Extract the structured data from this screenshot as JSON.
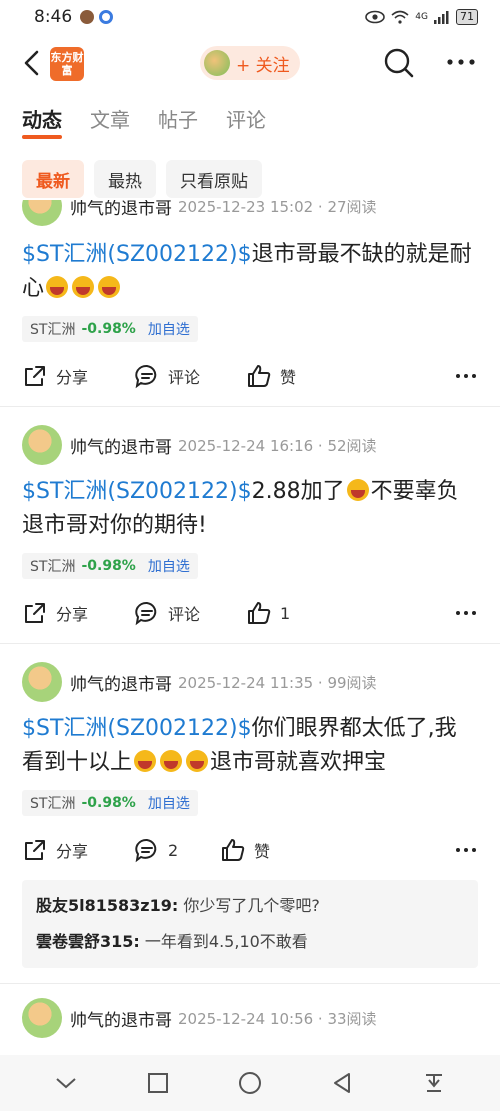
{
  "status_bar": {
    "time": "8:46",
    "network": "4G",
    "battery": "71"
  },
  "header": {
    "logo_text": "东方财富",
    "follow_label": "+ 关注"
  },
  "tabs": [
    {
      "label": "动态",
      "active": true
    },
    {
      "label": "文章",
      "active": false
    },
    {
      "label": "帖子",
      "active": false
    },
    {
      "label": "评论",
      "active": false
    }
  ],
  "filters": [
    {
      "label": "最新",
      "active": true
    },
    {
      "label": "最热",
      "active": false
    },
    {
      "label": "只看原贴",
      "active": false
    }
  ],
  "posts": [
    {
      "author": "帅气的退市哥",
      "meta": "2025-12-23 15:02 · 27阅读",
      "ticker": "$ST汇洲(SZ002122)$",
      "text": "退市哥最不缺的就是耐心",
      "emoji_count": 3,
      "stock": {
        "name": "ST汇洲",
        "change": "-0.98%",
        "add": "加自选"
      },
      "share": "分享",
      "comment": "评论",
      "like": "赞"
    },
    {
      "author": "帅气的退市哥",
      "meta": "2025-12-24 16:16 · 52阅读",
      "ticker": "$ST汇洲(SZ002122)$",
      "text_before": "2.88加了",
      "text_after": "不要辜负退市哥对你的期待!",
      "stock": {
        "name": "ST汇洲",
        "change": "-0.98%",
        "add": "加自选"
      },
      "share": "分享",
      "comment": "评论",
      "like": "1"
    },
    {
      "author": "帅气的退市哥",
      "meta": "2025-12-24 11:35 · 99阅读",
      "ticker": "$ST汇洲(SZ002122)$",
      "text_before": "你们眼界都太低了,我看到十以上",
      "text_after": "退市哥就喜欢押宝",
      "stock": {
        "name": "ST汇洲",
        "change": "-0.98%",
        "add": "加自选"
      },
      "share": "分享",
      "comment": "2",
      "like": "赞",
      "comments": [
        {
          "user": "股友5l81583z19:",
          "text": "你少写了几个零吧?"
        },
        {
          "user": "雲卷雲舒315:",
          "text": "一年看到4.5,10不敢看"
        }
      ]
    },
    {
      "author": "帅气的退市哥",
      "meta": "2025-12-24 10:56 · 33阅读"
    }
  ],
  "icons": {
    "back": "chevron-left-icon",
    "search": "search-icon",
    "more": "more-dots-icon",
    "share": "share-icon",
    "comment": "comment-icon",
    "like": "thumbs-up-icon"
  }
}
